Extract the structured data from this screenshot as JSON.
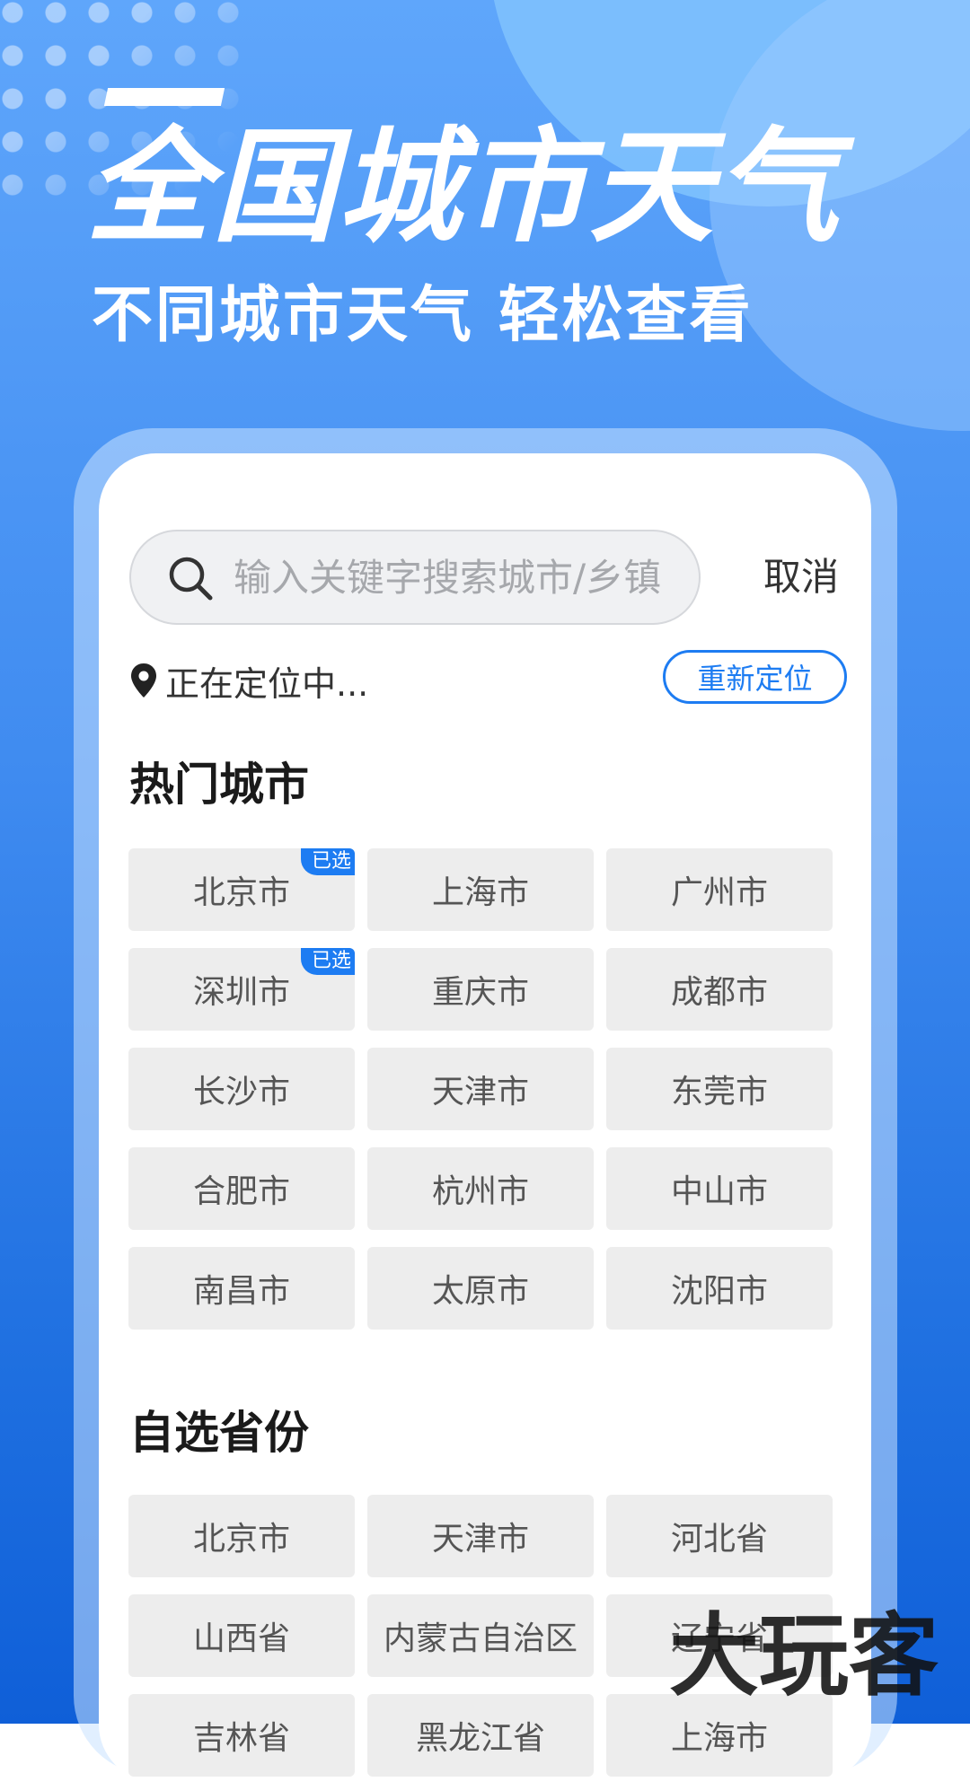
{
  "hero": {
    "title": "全国城市天气",
    "subtitle": "不同城市天气  轻松查看"
  },
  "search": {
    "placeholder": "输入关键字搜索城市/乡镇",
    "value": "",
    "cancel_label": "取消"
  },
  "location": {
    "status": "正在定位中...",
    "relocate_label": "重新定位"
  },
  "hot_cities": {
    "title": "热门城市",
    "badge_label": "已选",
    "items": [
      {
        "name": "北京市",
        "selected": true
      },
      {
        "name": "上海市",
        "selected": false
      },
      {
        "name": "广州市",
        "selected": false
      },
      {
        "name": "深圳市",
        "selected": true
      },
      {
        "name": "重庆市",
        "selected": false
      },
      {
        "name": "成都市",
        "selected": false
      },
      {
        "name": "长沙市",
        "selected": false
      },
      {
        "name": "天津市",
        "selected": false
      },
      {
        "name": "东莞市",
        "selected": false
      },
      {
        "name": "合肥市",
        "selected": false
      },
      {
        "name": "杭州市",
        "selected": false
      },
      {
        "name": "中山市",
        "selected": false
      },
      {
        "name": "南昌市",
        "selected": false
      },
      {
        "name": "太原市",
        "selected": false
      },
      {
        "name": "沈阳市",
        "selected": false
      }
    ]
  },
  "provinces": {
    "title": "自选省份",
    "items": [
      "北京市",
      "天津市",
      "河北省",
      "山西省",
      "内蒙古自治区",
      "辽宁省",
      "吉林省",
      "黑龙江省",
      "上海市"
    ]
  },
  "watermark": "大玩客",
  "colors": {
    "accent": "#1d7cf2",
    "tile_bg": "#ededed",
    "bg_top": "#5fa6fb",
    "bg_bottom": "#0f5fd8"
  }
}
